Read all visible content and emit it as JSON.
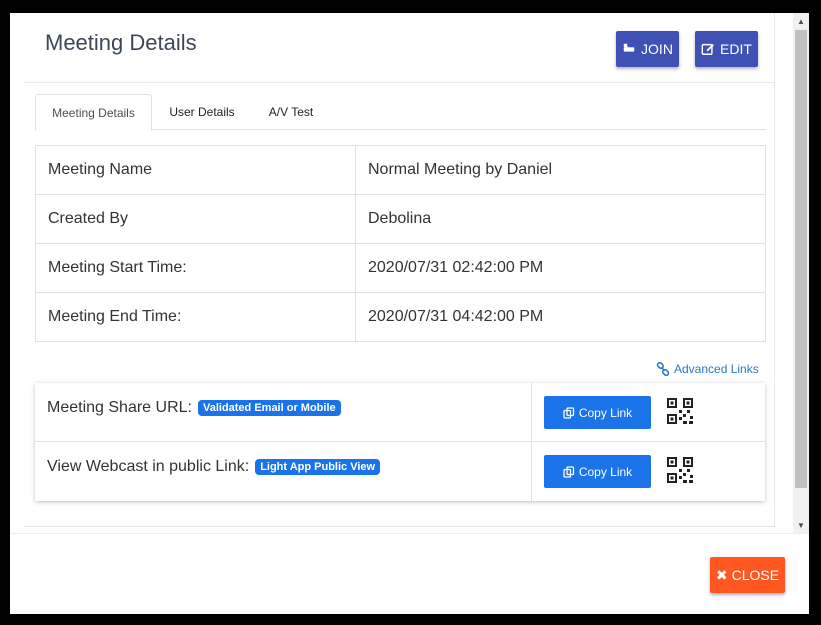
{
  "header": {
    "title": "Meeting Details",
    "join_label": "JOIN",
    "edit_label": "EDIT"
  },
  "tabs": [
    {
      "label": "Meeting Details",
      "active": true
    },
    {
      "label": "User Details",
      "active": false
    },
    {
      "label": "A/V Test",
      "active": false
    }
  ],
  "details": [
    {
      "label": "Meeting Name",
      "value": "Normal Meeting by Daniel"
    },
    {
      "label": "Created By",
      "value": "Debolina"
    },
    {
      "label": "Meeting Start Time:",
      "value": "2020/07/31 02:42:00 PM"
    },
    {
      "label": "Meeting End Time:",
      "value": "2020/07/31 04:42:00 PM"
    }
  ],
  "advanced_links_label": "Advanced Links",
  "share_links": [
    {
      "label": "Meeting Share URL:",
      "badge": "Validated Email or Mobile",
      "copy_label": "Copy Link",
      "icon": "qr-code-icon"
    },
    {
      "label": "View Webcast in public Link:",
      "badge": "Light App Public View",
      "copy_label": "Copy Link",
      "icon": "qr-code-icon"
    }
  ],
  "footer": {
    "close_label": "CLOSE"
  },
  "colors": {
    "primary": "#3f51b5",
    "link_blue": "#1a73e8",
    "close_orange": "#ff5722"
  }
}
